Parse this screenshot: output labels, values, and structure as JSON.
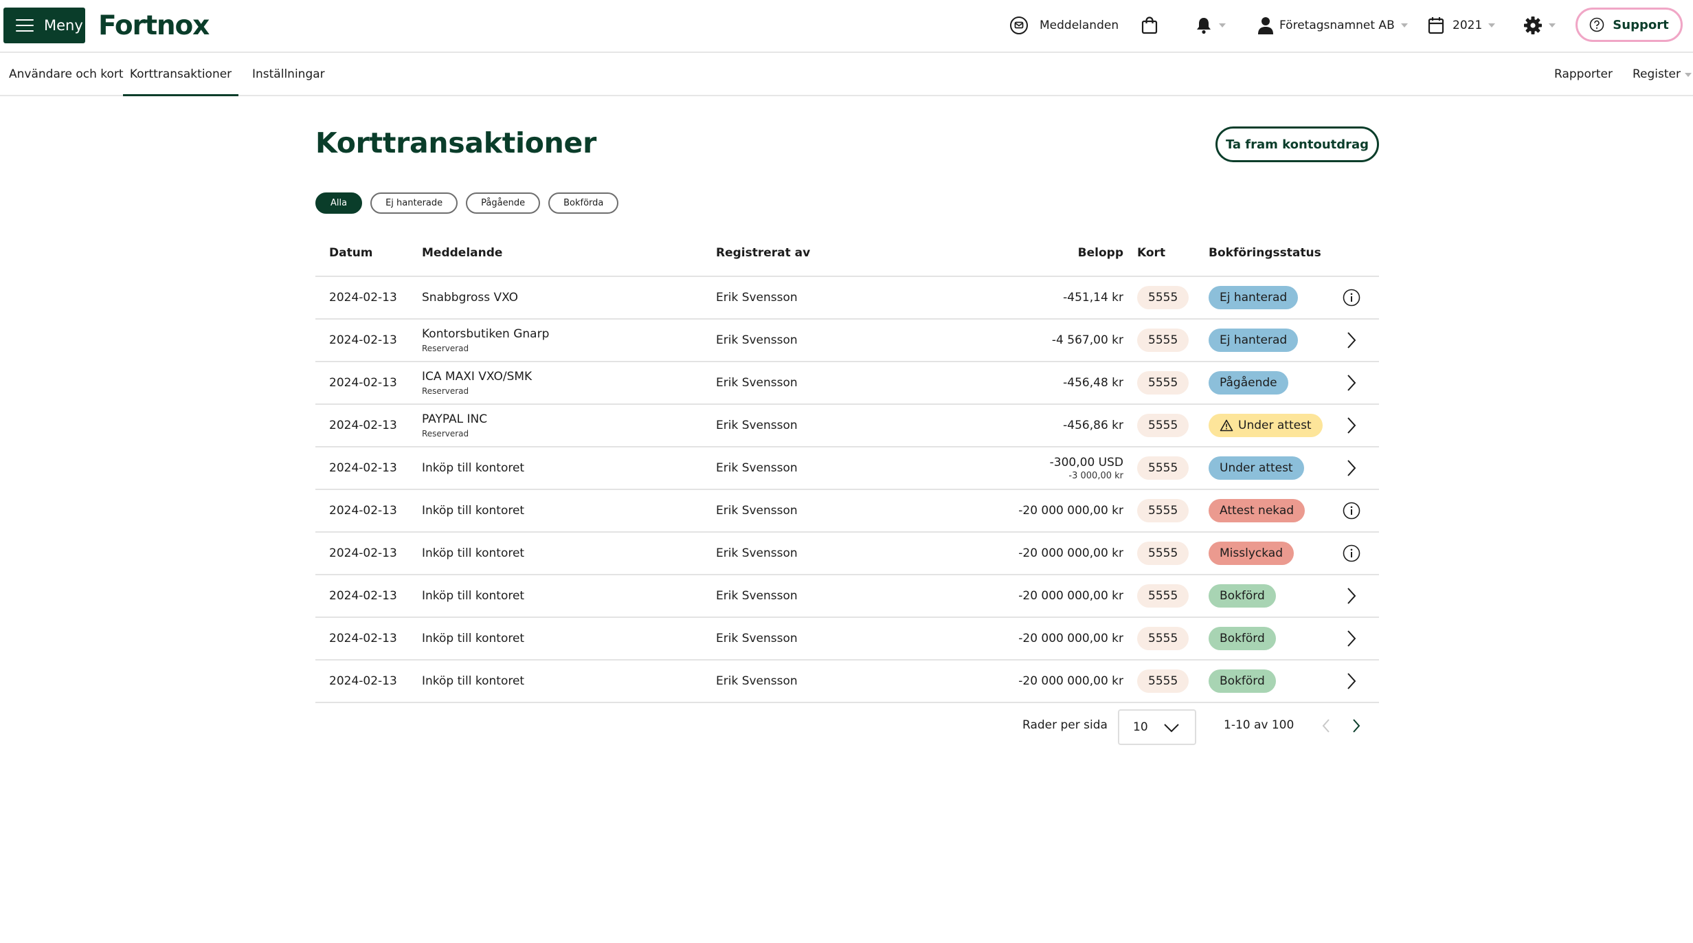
{
  "colors": {
    "brand": "#0a3d2a",
    "support_border": "#f0a6c6",
    "card_badge_bg": "#f9ece4",
    "status_blue": "#8cbfda",
    "status_yellow": "#fde59a",
    "status_red": "#eb9a8f",
    "status_green": "#a8d4b3"
  },
  "header": {
    "menu_label": "Meny",
    "logo_text": "Fortnox",
    "messages_label": "Meddelanden",
    "company_label": "Företagsnamnet AB",
    "year_label": "2021",
    "support_label": "Support"
  },
  "subnav": {
    "tabs": [
      {
        "label": "Användare och kort"
      },
      {
        "label": "Korttransaktioner"
      },
      {
        "label": "Inställningar"
      }
    ],
    "right": {
      "reports_label": "Rapporter",
      "register_label": "Register"
    }
  },
  "main": {
    "title": "Korttransaktioner",
    "statement_button": "Ta fram kontoutdrag",
    "filters": [
      "Alla",
      "Ej hanterade",
      "Pågående",
      "Bokförda"
    ],
    "columns": {
      "date": "Datum",
      "message": "Meddelande",
      "registered_by": "Registrerat av",
      "amount": "Belopp",
      "card": "Kort",
      "status": "Bokföringsstatus"
    },
    "rows": [
      {
        "date": "2024-02-13",
        "message": "Snabbgross VXO",
        "note": "",
        "registered_by": "Erik Svensson",
        "amount": "-451,14 kr",
        "amount_sub": "",
        "card": "5555",
        "status": "Ej hanterad",
        "status_color": "#8cbfda",
        "status_icon": "",
        "action_icon": "info-icon"
      },
      {
        "date": "2024-02-13",
        "message": "Kontorsbutiken Gnarp",
        "note": "Reserverad",
        "registered_by": "Erik Svensson",
        "amount": "-4 567,00 kr",
        "amount_sub": "",
        "card": "5555",
        "status": "Ej hanterad",
        "status_color": "#8cbfda",
        "status_icon": "",
        "action_icon": "chevron-right-icon"
      },
      {
        "date": "2024-02-13",
        "message": "ICA MAXI VXO/SMK",
        "note": "Reserverad",
        "registered_by": "Erik Svensson",
        "amount": "-456,48 kr",
        "amount_sub": "",
        "card": "5555",
        "status": "Pågående",
        "status_color": "#8cbfda",
        "status_icon": "",
        "action_icon": "chevron-right-icon"
      },
      {
        "date": "2024-02-13",
        "message": "PAYPAL INC",
        "note": "Reserverad",
        "registered_by": "Erik Svensson",
        "amount": "-456,86 kr",
        "amount_sub": "",
        "card": "5555",
        "status": "Under attest",
        "status_color": "#fde59a",
        "status_icon": "warning-icon",
        "action_icon": "chevron-right-icon"
      },
      {
        "date": "2024-02-13",
        "message": "Inköp till kontoret",
        "note": "",
        "registered_by": "Erik Svensson",
        "amount": "-300,00 USD",
        "amount_sub": "-3 000,00 kr",
        "card": "5555",
        "status": "Under attest",
        "status_color": "#8cbfda",
        "status_icon": "",
        "action_icon": "chevron-right-icon"
      },
      {
        "date": "2024-02-13",
        "message": "Inköp till kontoret",
        "note": "",
        "registered_by": "Erik Svensson",
        "amount": "-20 000 000,00 kr",
        "amount_sub": "",
        "card": "5555",
        "status": "Attest nekad",
        "status_color": "#eb9a8f",
        "status_icon": "",
        "action_icon": "info-icon"
      },
      {
        "date": "2024-02-13",
        "message": "Inköp till kontoret",
        "note": "",
        "registered_by": "Erik Svensson",
        "amount": "-20 000 000,00 kr",
        "amount_sub": "",
        "card": "5555",
        "status": "Misslyckad",
        "status_color": "#eb9a8f",
        "status_icon": "",
        "action_icon": "info-icon"
      },
      {
        "date": "2024-02-13",
        "message": "Inköp till kontoret",
        "note": "",
        "registered_by": "Erik Svensson",
        "amount": "-20 000 000,00 kr",
        "amount_sub": "",
        "card": "5555",
        "status": "Bokförd",
        "status_color": "#a8d4b3",
        "status_icon": "",
        "action_icon": "chevron-right-icon"
      },
      {
        "date": "2024-02-13",
        "message": "Inköp till kontoret",
        "note": "",
        "registered_by": "Erik Svensson",
        "amount": "-20 000 000,00 kr",
        "amount_sub": "",
        "card": "5555",
        "status": "Bokförd",
        "status_color": "#a8d4b3",
        "status_icon": "",
        "action_icon": "chevron-right-icon"
      },
      {
        "date": "2024-02-13",
        "message": "Inköp till kontoret",
        "note": "",
        "registered_by": "Erik Svensson",
        "amount": "-20 000 000,00 kr",
        "amount_sub": "",
        "card": "5555",
        "status": "Bokförd",
        "status_color": "#a8d4b3",
        "status_icon": "",
        "action_icon": "chevron-right-icon"
      }
    ]
  },
  "pagination": {
    "rows_label": "Rader per sida",
    "rows_value": "10",
    "range": "1-10 av 100"
  }
}
